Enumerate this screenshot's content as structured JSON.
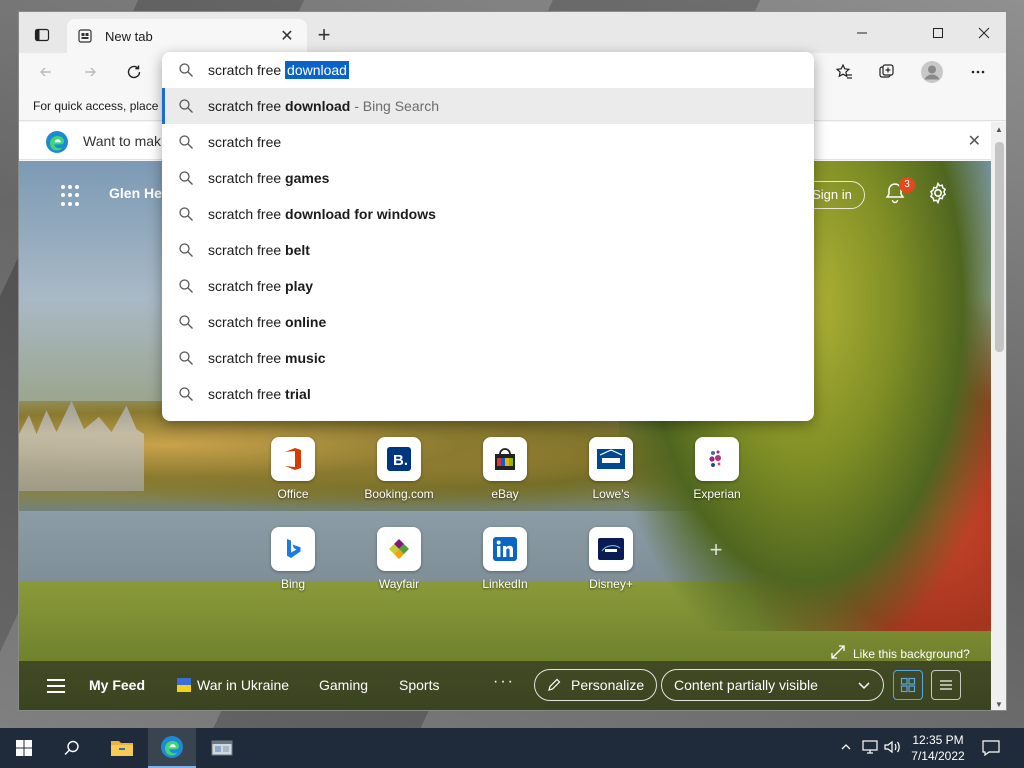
{
  "browser": {
    "tab_title": "New tab",
    "favbar_text": "For quick access, place y",
    "infobar_text": "Want to mak"
  },
  "address": {
    "typed": "scratch free ",
    "selected_completion": "download"
  },
  "suggestions": [
    {
      "prefix": "scratch free ",
      "bold": "download",
      "meta": " - Bing Search"
    },
    {
      "prefix": "scratch free",
      "bold": "",
      "meta": ""
    },
    {
      "prefix": "scratch free ",
      "bold": "games",
      "meta": ""
    },
    {
      "prefix": "scratch free ",
      "bold": "download for windows",
      "meta": ""
    },
    {
      "prefix": "scratch free ",
      "bold": "belt",
      "meta": ""
    },
    {
      "prefix": "scratch free ",
      "bold": "play",
      "meta": ""
    },
    {
      "prefix": "scratch free ",
      "bold": "online",
      "meta": ""
    },
    {
      "prefix": "scratch free ",
      "bold": "music",
      "meta": ""
    },
    {
      "prefix": "scratch free ",
      "bold": "trial",
      "meta": ""
    }
  ],
  "page": {
    "user_greeting": "Glen Hea",
    "sign_in": "Sign in",
    "notification_count": "3",
    "like_background": "Like this background?"
  },
  "quick_links": [
    {
      "label": "Office"
    },
    {
      "label": "Booking.com"
    },
    {
      "label": "eBay"
    },
    {
      "label": "Lowe's"
    },
    {
      "label": "Experian"
    },
    {
      "label": "Bing"
    },
    {
      "label": "Wayfair"
    },
    {
      "label": "LinkedIn"
    },
    {
      "label": "Disney+"
    }
  ],
  "feed": {
    "my_feed": "My Feed",
    "war_in_ukraine": "War in Ukraine",
    "gaming": "Gaming",
    "sports": "Sports",
    "more": "···",
    "personalize": "Personalize",
    "content_visibility": "Content partially visible"
  },
  "taskbar": {
    "time": "12:35 PM",
    "date": "7/14/2022"
  },
  "colors": {
    "accent": "#0a64c8",
    "taskbar": "#1f2b3a",
    "badge": "#e14a1e"
  }
}
